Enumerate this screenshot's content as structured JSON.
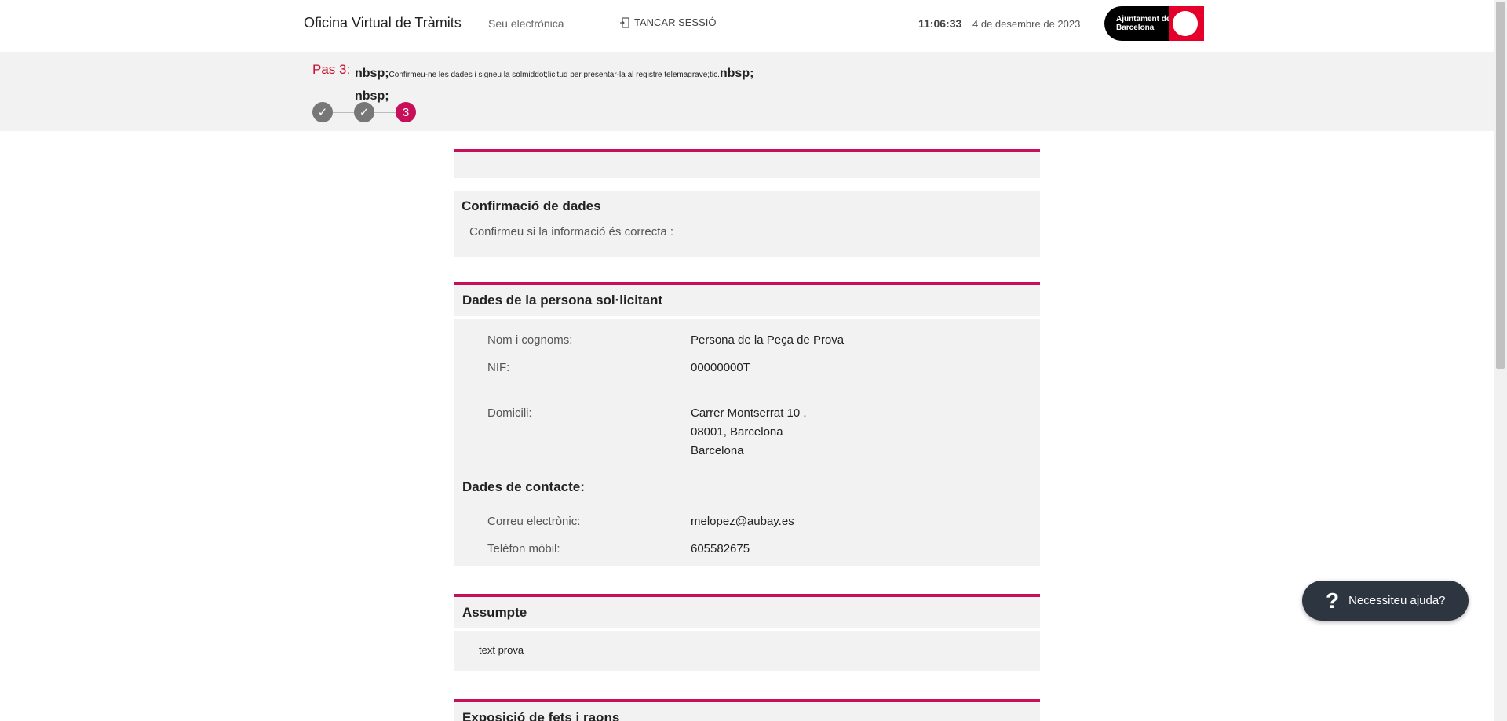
{
  "header": {
    "app_title": "Oficina Virtual de Tràmits",
    "seu_link": "Seu electrònica",
    "logout_label": "TANCAR SESSIÓ",
    "time": "11:06:33",
    "date": "4 de desembre de 2023",
    "logo_text": "Ajuntament de Barcelona"
  },
  "stepbar": {
    "step_label": "Pas 3:",
    "prefix": "nbsp;",
    "instruction": "Confirmeu-ne les dades i signeu la solmiddot;licitud per presentar-la al registre telemagrave;tic.",
    "suffix": "nbsp;",
    "line2": "nbsp;",
    "steps": [
      "✓",
      "✓",
      "3"
    ],
    "accent": "#c8105a"
  },
  "confirm": {
    "title": "Confirmació de dades",
    "subtitle": "Confirmeu si la informació és correcta :"
  },
  "applicant": {
    "title": "Dades de la persona sol·licitant",
    "name_label": "Nom i cognoms:",
    "name_value": "Persona de la Peça de Prova",
    "nif_label": "NIF:",
    "nif_value": "00000000T",
    "address_label": "Domicili:",
    "address_line1": "Carrer Montserrat 10 ,",
    "address_line2": "08001, Barcelona",
    "address_line3": "Barcelona",
    "contact_title": "Dades de contacte:",
    "email_label": "Correu electrònic:",
    "email_value": "melopez@aubay.es",
    "phone_label": "Telèfon mòbil:",
    "phone_value": "605582675"
  },
  "subject": {
    "title": "Assumpte",
    "text": "text prova"
  },
  "facts": {
    "title": "Exposició de fets i raons"
  },
  "help": {
    "icon": "?",
    "label": "Necessiteu ajuda?"
  }
}
